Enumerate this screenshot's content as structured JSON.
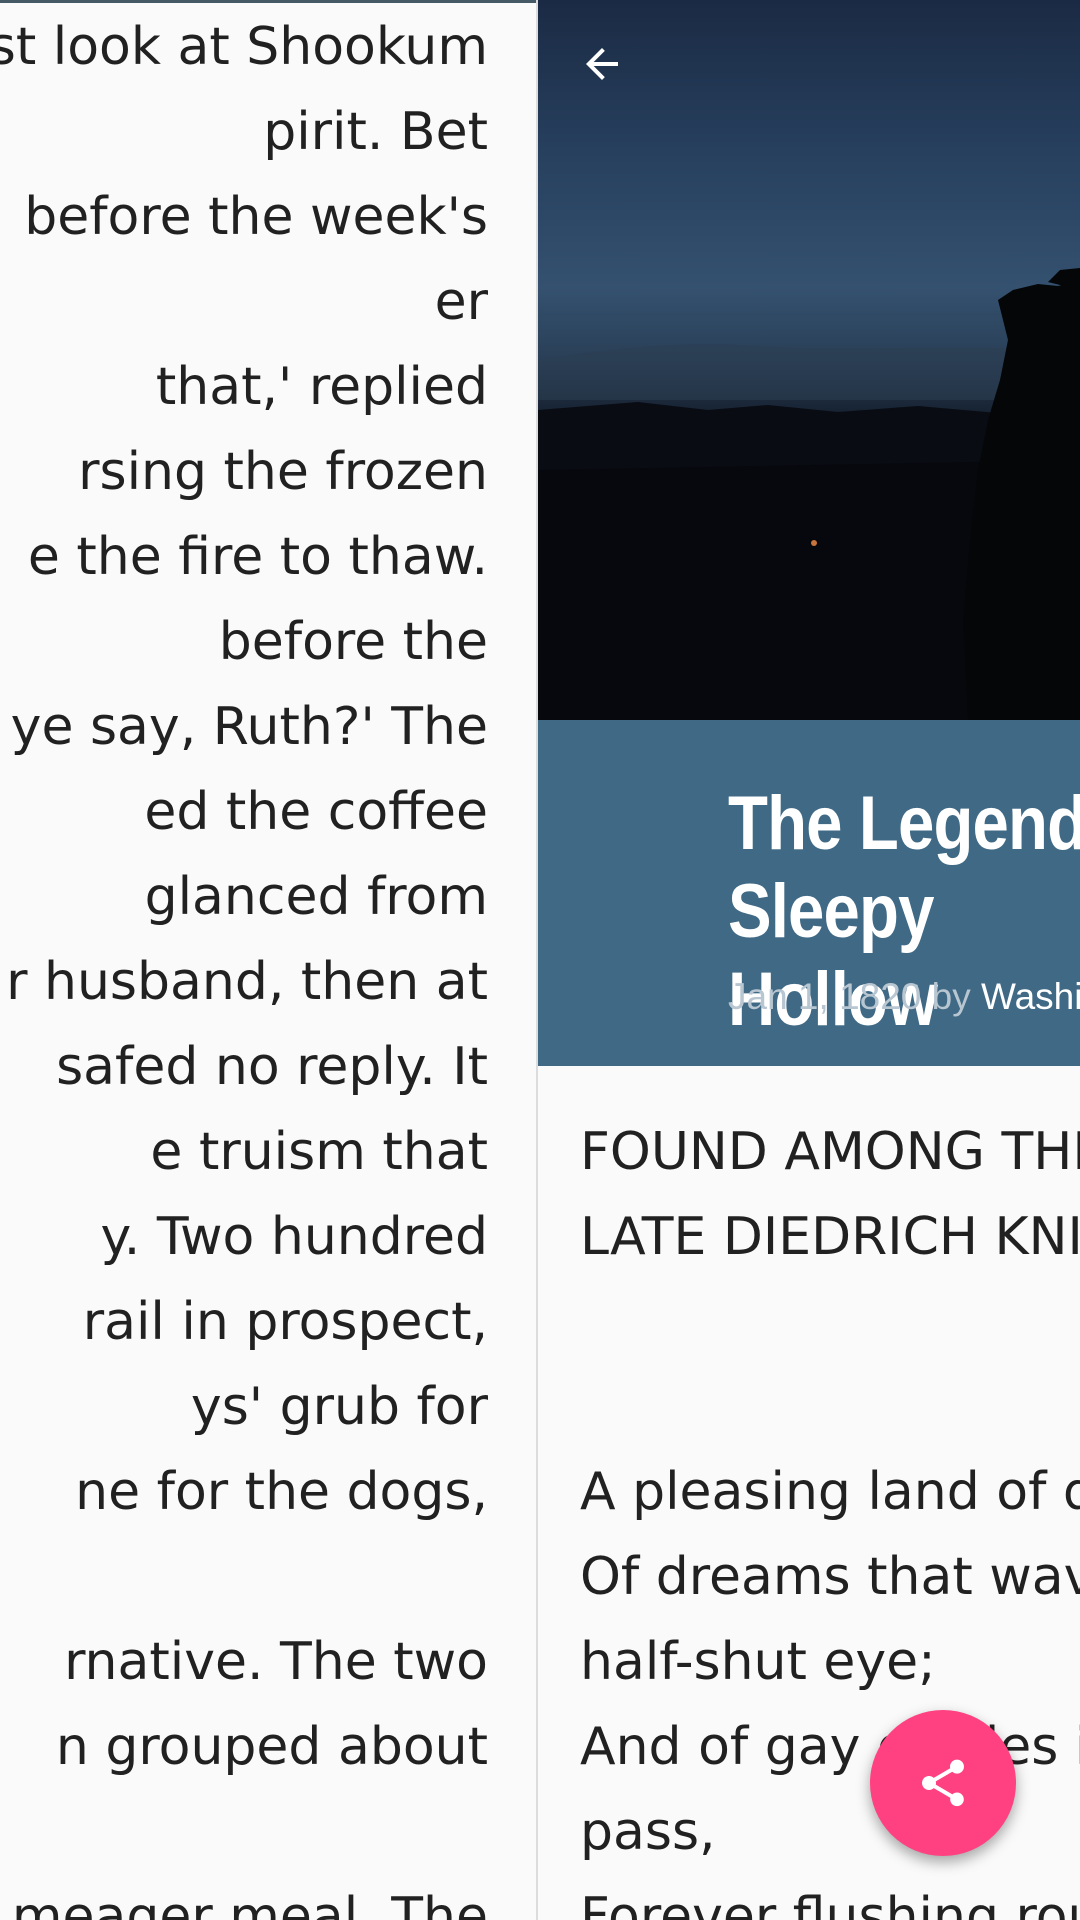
{
  "left_pane": {
    "lines": [
      "st look at Shookum",
      "pirit. Bet",
      "before the week's",
      "er",
      " that,' replied",
      "rsing the frozen",
      "e the fire to thaw.",
      "before the",
      "ye say, Ruth?' The",
      "ed the coffee",
      "glanced from",
      "r husband, then at",
      "safed no reply. It",
      "e truism that",
      "y. Two hundred",
      "rail in prospect,",
      "ys' grub for",
      "ne for the dogs,",
      "",
      "rnative. The two",
      "n grouped about",
      "",
      " meager meal. The"
    ]
  },
  "header": {
    "back_icon": "arrow-back-icon",
    "title_line1": "The Legend of Sleepy",
    "title_line2": "Hollow",
    "date": "Jan 1, 1820",
    "by": " by ",
    "author": "Washington Irving",
    "colors": {
      "band": "#3f6985",
      "title": "#ffffff",
      "meta_muted": "#b8c6d1"
    }
  },
  "article": {
    "heading_lines": [
      "FOUND AMONG THE PAPERS OF THE",
      "LATE DIEDRICH KNICKERBOCKER."
    ],
    "poem_lines": [
      "A pleasing land of drowsy head it was,",
      "Of dreams that wave before the",
      "half-shut eye;",
      "And of gay castles in the clouds that",
      "pass,",
      "Forever flushing round a summer sky."
    ]
  },
  "fab": {
    "icon": "share-icon",
    "color": "#ff4081"
  }
}
